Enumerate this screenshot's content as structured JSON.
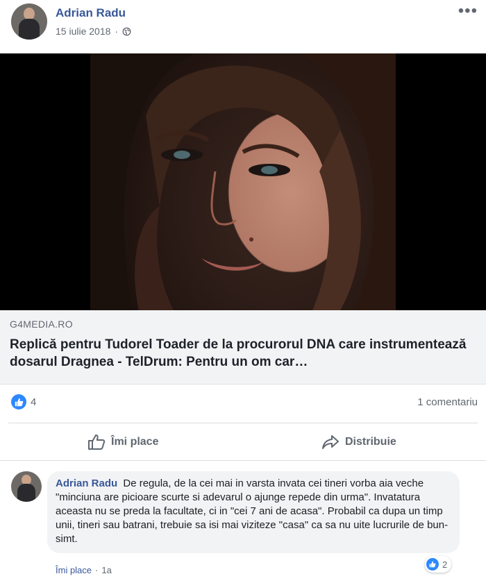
{
  "post": {
    "author": "Adrian Radu",
    "date": "15 iulie 2018",
    "separator": "·",
    "menu_glyph": "•••",
    "privacy_icon": "globe-icon"
  },
  "link": {
    "domain": "G4MEDIA.RO",
    "title": "Replică pentru Tudorel Toader de la procurorul DNA care instrumentează dosarul Dragnea - TelDrum: Pentru un om car…"
  },
  "stats": {
    "likes": "4",
    "comments": "1 comentariu",
    "like_color": "#2d88ff"
  },
  "actions": {
    "like": "Îmi place",
    "share": "Distribuie"
  },
  "comment": {
    "author": "Adrian Radu",
    "text": "De regula, de la cei mai in varsta invata cei tineri vorba aia veche \"minciuna are picioare scurte si adevarul o ajunge repede din urma\". Invatatura aceasta nu se preda la facultate, ci in \"cei 7 ani de acasa\". Probabil ca dupa un timp unii, tineri sau batrani, trebuie sa isi mai viziteze \"casa\" ca sa nu uite lucrurile de bun-simt.",
    "reactions": "2",
    "like_link": "Îmi place",
    "separator": "·",
    "time": "1a"
  }
}
